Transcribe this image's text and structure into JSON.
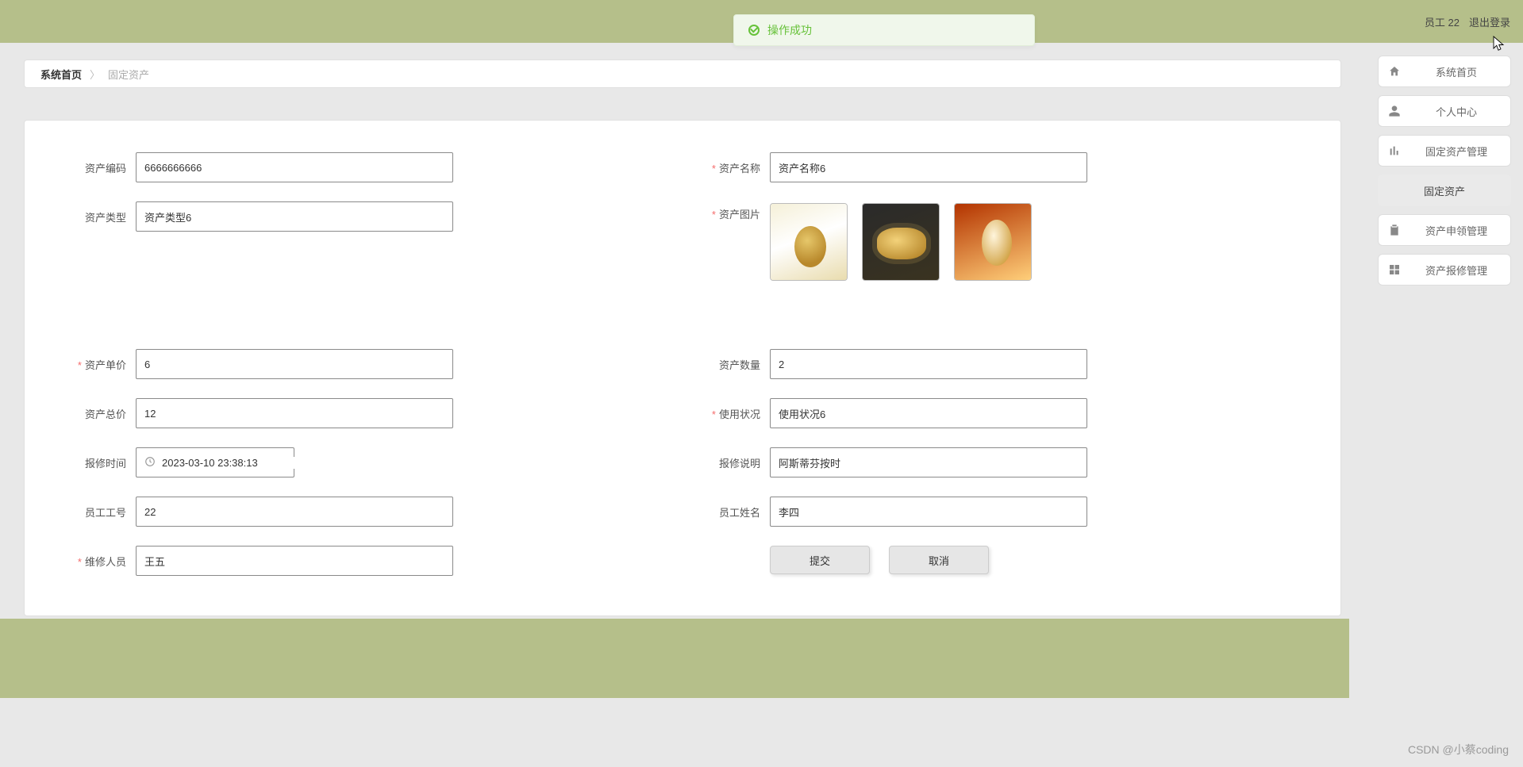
{
  "header": {
    "user_label": "员工 22",
    "logout_label": "退出登录"
  },
  "toast": {
    "message": "操作成功"
  },
  "breadcrumb": {
    "home": "系统首页",
    "current": "固定资产"
  },
  "sidebar": {
    "items": [
      {
        "id": "home",
        "label": "系统首页",
        "icon": "home-icon"
      },
      {
        "id": "profile",
        "label": "个人中心",
        "icon": "person-icon"
      },
      {
        "id": "asset-mgmt",
        "label": "固定资产管理",
        "icon": "bar-chart-icon"
      },
      {
        "id": "asset-sub",
        "label": "固定资产",
        "is_sub": true
      },
      {
        "id": "apply",
        "label": "资产申领管理",
        "icon": "clipboard-icon"
      },
      {
        "id": "repair",
        "label": "资产报修管理",
        "icon": "grid-icon"
      }
    ]
  },
  "form": {
    "asset_code": {
      "label": "资产编码",
      "value": "6666666666"
    },
    "asset_name": {
      "label": "资产名称",
      "value": "资产名称6",
      "required": true
    },
    "asset_type": {
      "label": "资产类型",
      "value": "资产类型6"
    },
    "asset_image": {
      "label": "资产图片",
      "required": true,
      "images": [
        "img1",
        "img2",
        "img3"
      ]
    },
    "unit_price": {
      "label": "资产单价",
      "value": "6",
      "required": true
    },
    "quantity": {
      "label": "资产数量",
      "value": "2"
    },
    "total_price": {
      "label": "资产总价",
      "value": "12"
    },
    "usage_status": {
      "label": "使用状况",
      "value": "使用状况6",
      "required": true
    },
    "repair_time": {
      "label": "报修时间",
      "value": "2023-03-10 23:38:13"
    },
    "repair_desc": {
      "label": "报修说明",
      "value": "阿斯蒂芬按时"
    },
    "emp_no": {
      "label": "员工工号",
      "value": "22"
    },
    "emp_name": {
      "label": "员工姓名",
      "value": "李四"
    },
    "repair_person": {
      "label": "维修人员",
      "value": "王五",
      "required": true
    }
  },
  "buttons": {
    "submit": "提交",
    "cancel": "取消"
  },
  "watermark": "CSDN @小蔡coding"
}
